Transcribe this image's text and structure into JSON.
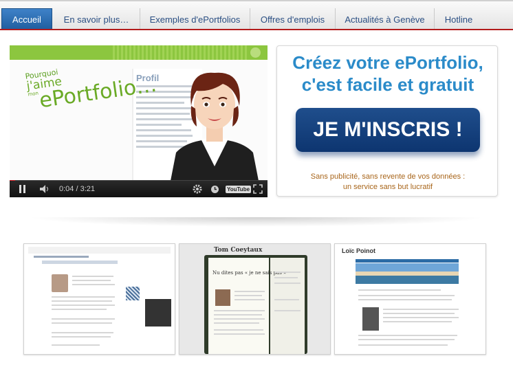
{
  "nav": {
    "tabs": [
      {
        "label": "Accueil",
        "active": true
      },
      {
        "label": "En savoir plus…",
        "active": false
      },
      {
        "label": "Exemples d'ePortfolios",
        "active": false
      },
      {
        "label": "Offres d'emplois",
        "active": false
      },
      {
        "label": "Actualités à Genève",
        "active": false
      },
      {
        "label": "Hotline",
        "active": false
      }
    ]
  },
  "video": {
    "headline_small": "Pourquoi",
    "headline_mid": "j'aime",
    "headline_tiny": "mon",
    "headline_big": "ePortfolio…",
    "doc_heading": "Profil",
    "time": "0:04 / 3:21",
    "progress": 0.02,
    "brand": "YouTube"
  },
  "signup": {
    "title_line1": "Créez votre ePortfolio,",
    "title_line2": "c'est facile et gratuit",
    "button": "JE M'INSCRIS !",
    "note_line1": "Sans publicité, sans revente de vos données :",
    "note_line2": "un service sans but lucratif"
  },
  "examples": [
    {
      "title": ""
    },
    {
      "title": "Tom Coeytaux"
    },
    {
      "title": "Loïc Poinot"
    }
  ],
  "colors": {
    "accent": "#2b8bc9",
    "button": "#0d3570",
    "nav_active": "#2c6fb3",
    "note": "#a8651a",
    "green": "#8cc63f"
  }
}
